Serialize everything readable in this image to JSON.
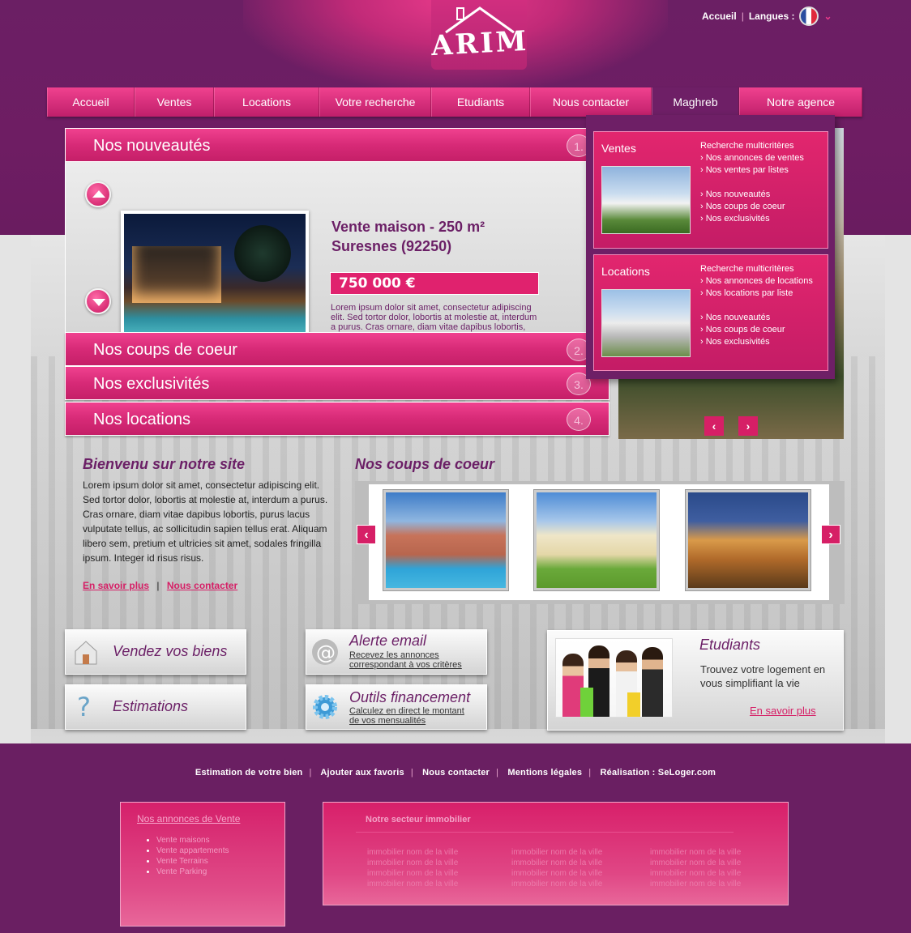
{
  "header": {
    "logo_text": "ARIM",
    "top_links": {
      "home": "Accueil",
      "languages": "Langues :"
    }
  },
  "nav": {
    "items": [
      {
        "label": "Accueil"
      },
      {
        "label": "Ventes"
      },
      {
        "label": "Locations"
      },
      {
        "label": "Votre recherche"
      },
      {
        "label": "Etudiants"
      },
      {
        "label": "Nous contacter"
      },
      {
        "label": "Maghreb"
      },
      {
        "label": "Notre agence"
      }
    ],
    "active": "Maghreb"
  },
  "mega_menu": {
    "sections": [
      {
        "title": "Ventes",
        "links": [
          "Recherche multicritères",
          "Nos annonces de ventes",
          "Nos ventes par listes",
          "Nos nouveautés",
          "Nos coups de coeur",
          "Nos exclusivités"
        ]
      },
      {
        "title": "Locations",
        "links": [
          "Recherche multicritères",
          "Nos annonces de locations",
          "Nos locations par liste",
          "Nos nouveautés",
          "Nos coups de coeur",
          "Nos exclusivités"
        ]
      }
    ]
  },
  "accordion": {
    "panels": [
      {
        "title": "Nos nouveautés",
        "num": "1."
      },
      {
        "title": "Nos coups de coeur",
        "num": "2."
      },
      {
        "title": "Nos exclusivités",
        "num": "3."
      },
      {
        "title": "Nos locations",
        "num": "4."
      }
    ],
    "featured": {
      "title_line1": "Vente maison - 250 m²",
      "title_line2": "Suresnes (92250)",
      "price": "750 000 €",
      "description": "Lorem ipsum dolor sit amet, consectetur adipiscing elit. Sed tortor dolor, lobortis at molestie at, interdum a purus. Cras ornare, diam vitae dapibus lobortis, purus lacus vulputate tellus, ac sollicitudin sapien tellus"
    }
  },
  "welcome": {
    "title": "Bienvenu sur notre site",
    "text": "Lorem ipsum dolor sit amet, consectetur adipiscing elit. Sed tortor dolor, lobortis at molestie at, interdum a purus. Cras ornare, diam vitae dapibus lobortis, purus lacus vulputate tellus, ac sollicitudin sapien tellus erat. Aliquam libero sem, pretium et ultricies sit amet, sodales fringilla ipsum. Integer id risus risus.",
    "link_more": "En savoir plus",
    "link_sep": "|",
    "link_contact": "Nous contacter"
  },
  "coups_de_coeur": {
    "title": "Nos coups de coeur"
  },
  "features": {
    "sell": "Vendez vos biens",
    "estimate": "Estimations",
    "alert_title": "Alerte email",
    "alert_sub1": "Recevez les annonces",
    "alert_sub2": "correspondant à vos critères",
    "tools_title": "Outils financement",
    "tools_sub1": "Calculez en direct le montant",
    "tools_sub2": "de vos mensualités"
  },
  "students": {
    "title": "Etudiants",
    "text": "Trouvez votre logement en vous simplifiant la vie",
    "link": "En savoir plus"
  },
  "footer": {
    "links": [
      "Estimation de votre bien",
      "Ajouter aux favoris",
      "Nous contacter",
      "Mentions légales",
      "Réalisation : SeLoger.com"
    ],
    "sep": "|",
    "sales_title": "Nos annonces de Vente",
    "sales_items": [
      "Vente maisons",
      "Vente appartements",
      "Vente Terrains",
      "Vente Parking"
    ],
    "sector_title": "Notre secteur immobilier",
    "sector_item": "immobilier nom de la ville"
  },
  "colors": {
    "brand_pink": "#d61f66",
    "brand_purple": "#6b1f66"
  }
}
